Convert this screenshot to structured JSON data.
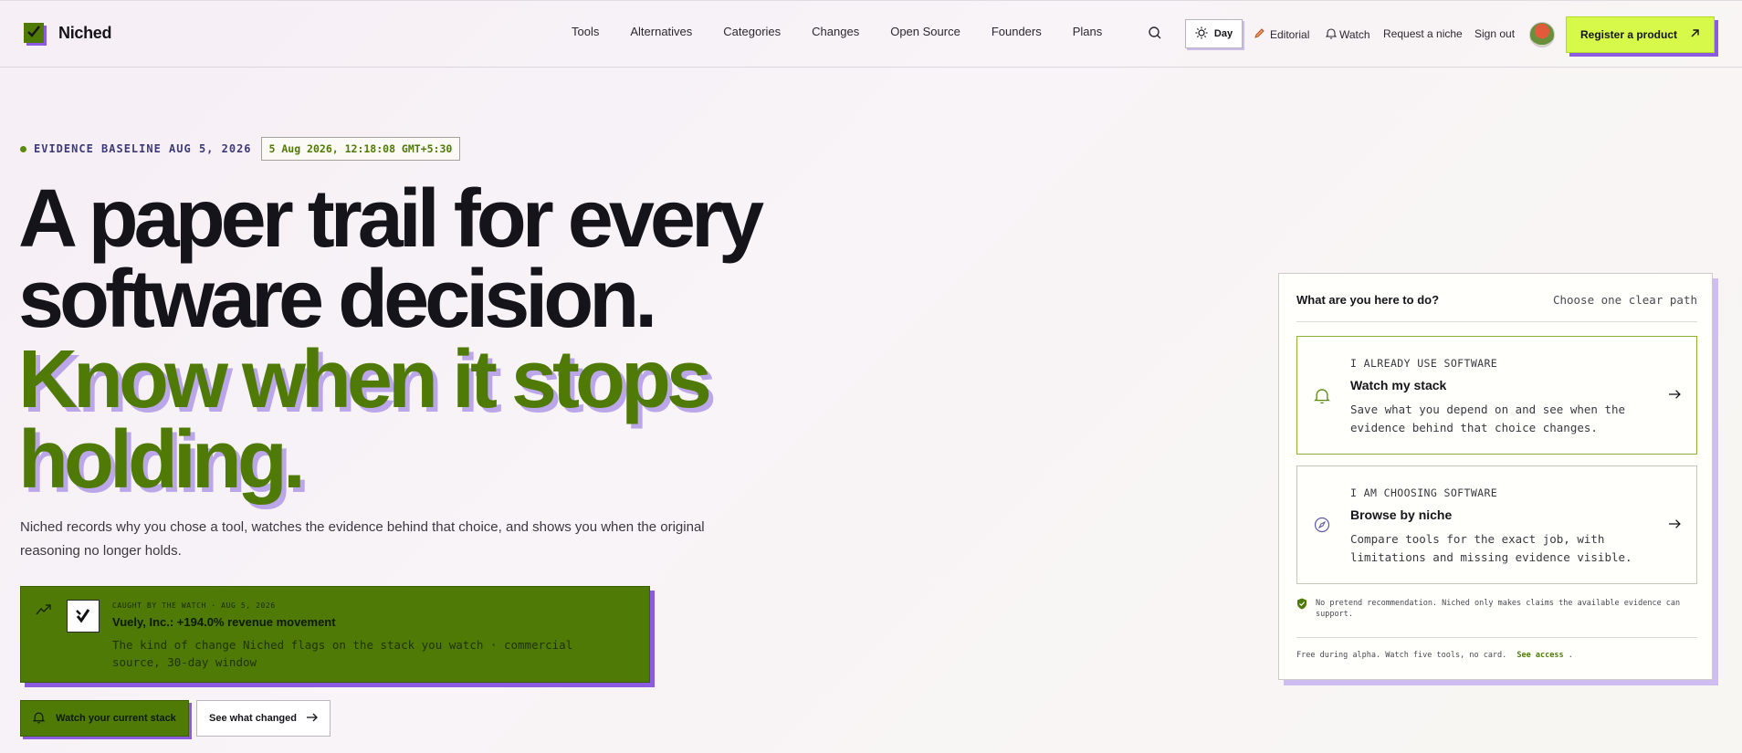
{
  "brand": {
    "name": "Niched"
  },
  "nav": [
    "Tools",
    "Alternatives",
    "Categories",
    "Changes",
    "Open Source",
    "Founders",
    "Plans"
  ],
  "header": {
    "theme_label": "Day",
    "editorial": "Editorial",
    "watch": "Watch",
    "request": "Request a niche",
    "signout": "Sign out",
    "register": "Register a product"
  },
  "hero": {
    "baseline_label": "EVIDENCE BASELINE AUG 5, 2026",
    "baseline_stamp": "5 Aug 2026, 12:18:08 GMT+5:30",
    "headline_1": "A paper trail for every",
    "headline_2": "software decision.",
    "headline_3": "Know when it stops",
    "headline_4": "holding.",
    "subcopy": "Niched records why you chose a tool, watches the evidence behind that choice, and shows you when the original reasoning no longer holds."
  },
  "alert": {
    "kicker": "CAUGHT BY THE WATCH · AUG 5, 2026",
    "title": "Vuely, Inc.: +194.0% revenue movement",
    "desc": "The kind of change Niched flags on the stack you watch · commercial source, 30-day window"
  },
  "cta": {
    "primary": "Watch your current stack",
    "secondary": "See what changed"
  },
  "panel": {
    "question": "What are you here to do?",
    "hint": "Choose one clear path",
    "options": [
      {
        "kicker": "I ALREADY USE SOFTWARE",
        "title": "Watch my stack",
        "desc": "Save what you depend on and see when the evidence behind that choice changes.",
        "icon": "bell-icon"
      },
      {
        "kicker": "I AM CHOOSING SOFTWARE",
        "title": "Browse by niche",
        "desc": "Compare tools for the exact job, with limitations and missing evidence visible.",
        "icon": "compass-icon"
      }
    ],
    "note": "No pretend recommendation. Niched only makes claims the available evidence can support.",
    "footer_text": "Free during alpha. Watch five tools, no card.",
    "footer_link": "See access",
    "footer_end": "."
  },
  "colors": {
    "accent_green": "#4f7a06",
    "accent_lime": "#d6f94a",
    "accent_purple": "#8b5ce0"
  }
}
